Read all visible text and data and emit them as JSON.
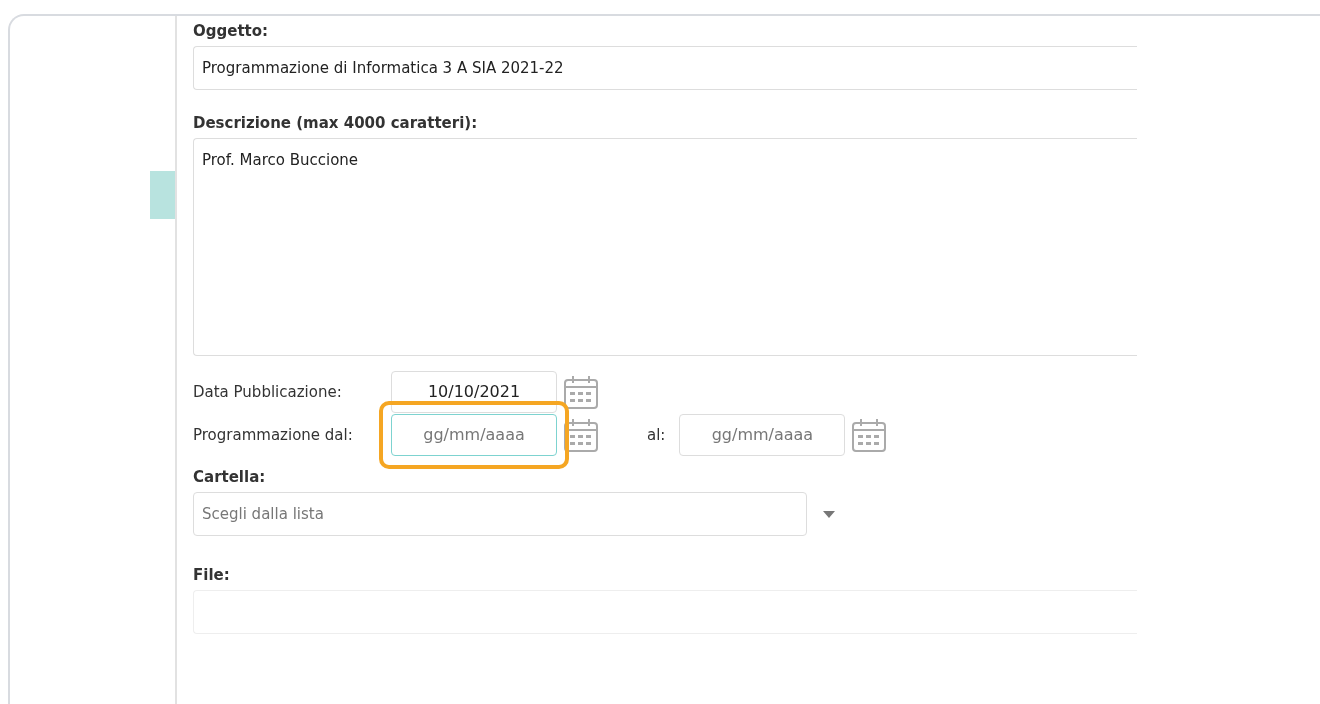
{
  "oggetto": {
    "label": "Oggetto:",
    "value": "Programmazione di Informatica 3 A SIA 2021-22"
  },
  "descrizione": {
    "label": "Descrizione (max 4000 caratteri):",
    "value": "Prof. Marco Buccione"
  },
  "date_rows": [
    {
      "label": "Data Pubblicazione:",
      "from": {
        "value": "10/10/2021",
        "focused": false,
        "highlighted": false
      }
    },
    {
      "label": "Programmazione dal:",
      "from": {
        "placeholder": "gg/mm/aaaa",
        "focused": true,
        "highlighted": true
      },
      "to_label": "al:",
      "to": {
        "placeholder": "gg/mm/aaaa",
        "focused": false,
        "highlighted": false
      }
    }
  ],
  "cartella": {
    "label": "Cartella:",
    "placeholder": "Scegli dalla lista"
  },
  "file": {
    "label": "File:"
  }
}
